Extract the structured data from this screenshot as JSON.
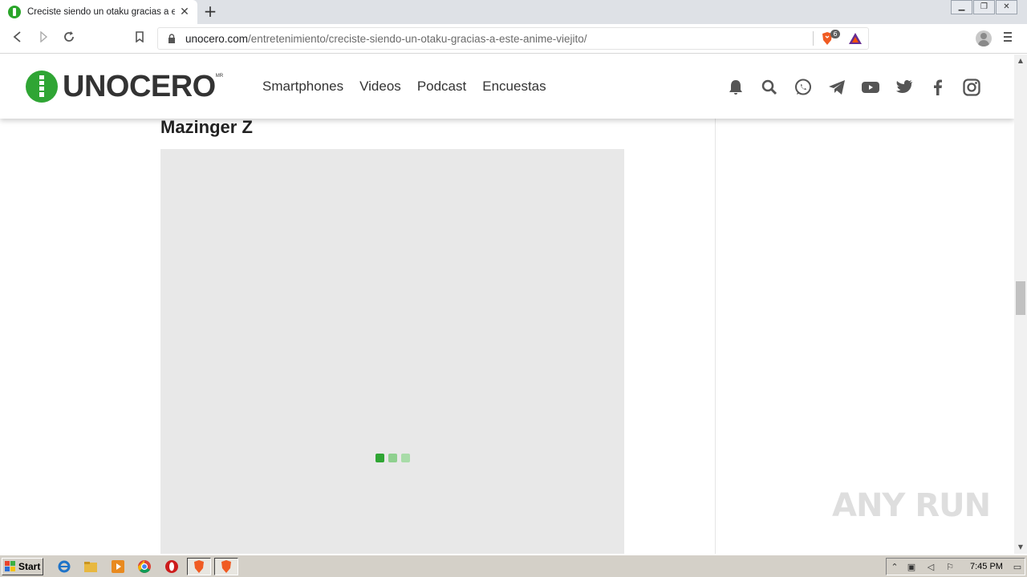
{
  "browser": {
    "tab_title": "Creciste siendo un otaku gracias a este anime viejito",
    "tab_close": "✕",
    "new_tab": "+",
    "url_host": "unocero.com",
    "url_path": "/entretenimiento/creciste-siendo-un-otaku-gracias-a-este-anime-viejito/",
    "shield_count": "6"
  },
  "site": {
    "logo_text": "UNOCERO",
    "logo_tm": "MR",
    "nav": [
      "Smartphones",
      "Videos",
      "Podcast",
      "Encuestas"
    ],
    "icons": [
      "bell-icon",
      "search-icon",
      "whatsapp-icon",
      "telegram-icon",
      "youtube-icon",
      "twitter-icon",
      "facebook-icon",
      "instagram-icon"
    ],
    "brand_color": "#2fa534"
  },
  "article": {
    "section_title": "Mazinger Z",
    "loader_colors": [
      "#2fa534",
      "#8fd08f",
      "#a8dca8"
    ]
  },
  "watermark": "ANY  RUN",
  "taskbar": {
    "start_label": "Start",
    "clock": "7:45 PM"
  }
}
